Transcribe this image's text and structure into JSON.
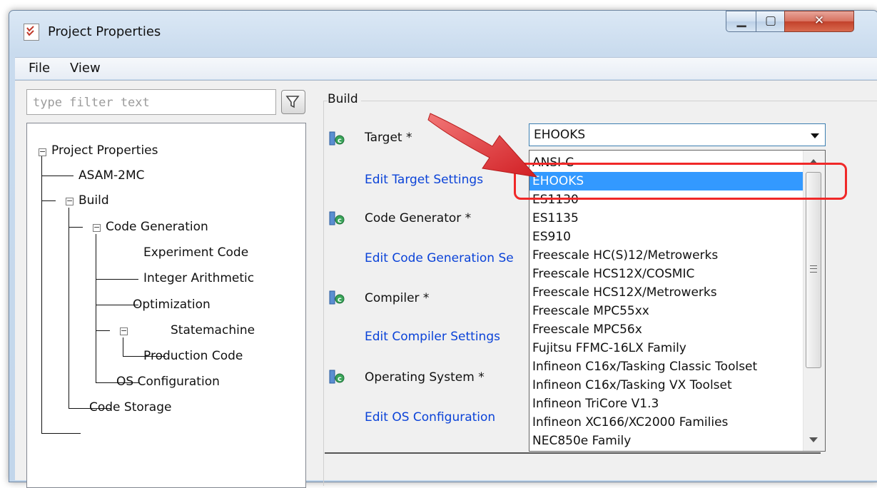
{
  "window": {
    "title": "Project Properties",
    "app_icon": "checklist-icon",
    "buttons": {
      "minimize": "minimize-icon",
      "maximize": "maximize-icon",
      "close": "close-icon"
    }
  },
  "menu": [
    "File",
    "View"
  ],
  "filter": {
    "placeholder": "type filter text",
    "button_icon": "filter-icon"
  },
  "tree": [
    {
      "label": "Project Properties",
      "expander": "−"
    },
    {
      "label": "ASAM-2MC"
    },
    {
      "label": "Build",
      "expander": "−"
    },
    {
      "label": "Code Generation",
      "expander": "−"
    },
    {
      "label": "Experiment Code"
    },
    {
      "label": "Integer Arithmetic"
    },
    {
      "label": "Optimization",
      "expander": "−"
    },
    {
      "label": "Statemachine"
    },
    {
      "label": "Production Code"
    },
    {
      "label": "OS Configuration"
    },
    {
      "label": "Code Storage"
    }
  ],
  "build": {
    "group_label": "Build",
    "target_label": "Target *",
    "target_link": "Edit Target Settings",
    "codegen_label": "Code Generator *",
    "codegen_link": "Edit Code Generation Se",
    "compiler_label": "Compiler *",
    "compiler_link": "Edit Compiler Settings",
    "os_label": "Operating System *",
    "os_link": "Edit OS Configuration",
    "property_icon": "component-icon"
  },
  "target_combo": {
    "value": "EHOOKS",
    "options": [
      "ANSI-C",
      "EHOOKS",
      "ES1130",
      "ES1135",
      "ES910",
      "Freescale HC(S)12/Metrowerks",
      "Freescale HCS12X/COSMIC",
      "Freescale HCS12X/Metrowerks",
      "Freescale MPC55xx",
      "Freescale MPC56x",
      "Fujitsu FFMC-16LX Family",
      "Infineon C16x/Tasking Classic Toolset",
      "Infineon C16x/Tasking VX Toolset",
      "Infineon TriCore V1.3",
      "Infineon XC166/XC2000 Families",
      "NEC850e Family"
    ],
    "selected_index": 1
  },
  "annotation": {
    "arrow_color": "#e8252a",
    "box_color": "#f02828"
  },
  "colors": {
    "link": "#0b43d8",
    "selection": "#3399ff"
  }
}
